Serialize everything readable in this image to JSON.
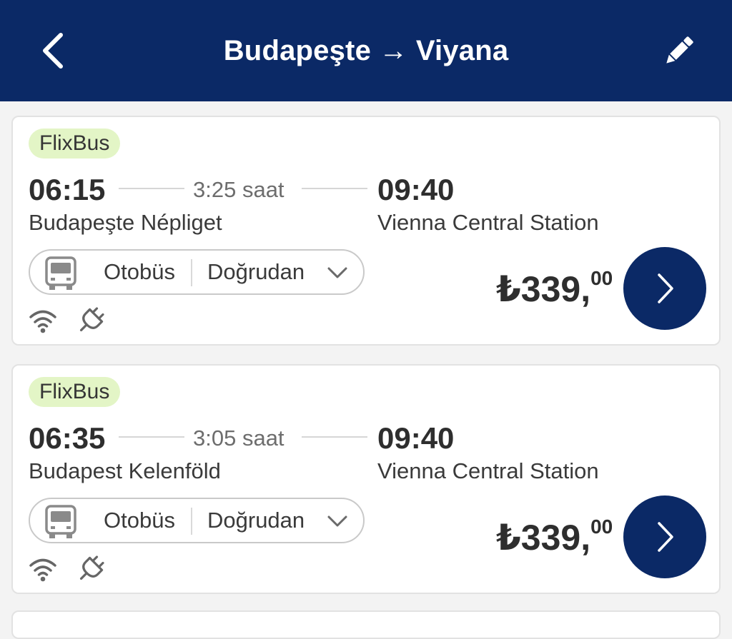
{
  "header": {
    "title": "Budapeşte → Viyana",
    "back_icon": "chevron-left-icon",
    "edit_icon": "pencil-icon",
    "background_color": "#0b2966"
  },
  "trips": [
    {
      "operator": "FlixBus",
      "departure_time": "06:15",
      "duration": "3:25 saat",
      "arrival_time": "09:40",
      "departure_station": "Budapeşte Népliget",
      "arrival_station": "Vienna Central Station",
      "transport_type": "Otobüs",
      "route_type": "Doğrudan",
      "amenities": [
        "wifi-icon",
        "plug-icon"
      ],
      "price_main": "₺339,",
      "price_decimals": "00"
    },
    {
      "operator": "FlixBus",
      "departure_time": "06:35",
      "duration": "3:05 saat",
      "arrival_time": "09:40",
      "departure_station": "Budapest Kelenföld",
      "arrival_station": "Vienna Central Station",
      "transport_type": "Otobüs",
      "route_type": "Doğrudan",
      "amenities": [
        "wifi-icon",
        "plug-icon"
      ],
      "price_main": "₺339,",
      "price_decimals": "00"
    }
  ],
  "colors": {
    "brand_navy": "#0b2966",
    "operator_badge": "#e3f5c6",
    "background": "#f3f3f3"
  }
}
